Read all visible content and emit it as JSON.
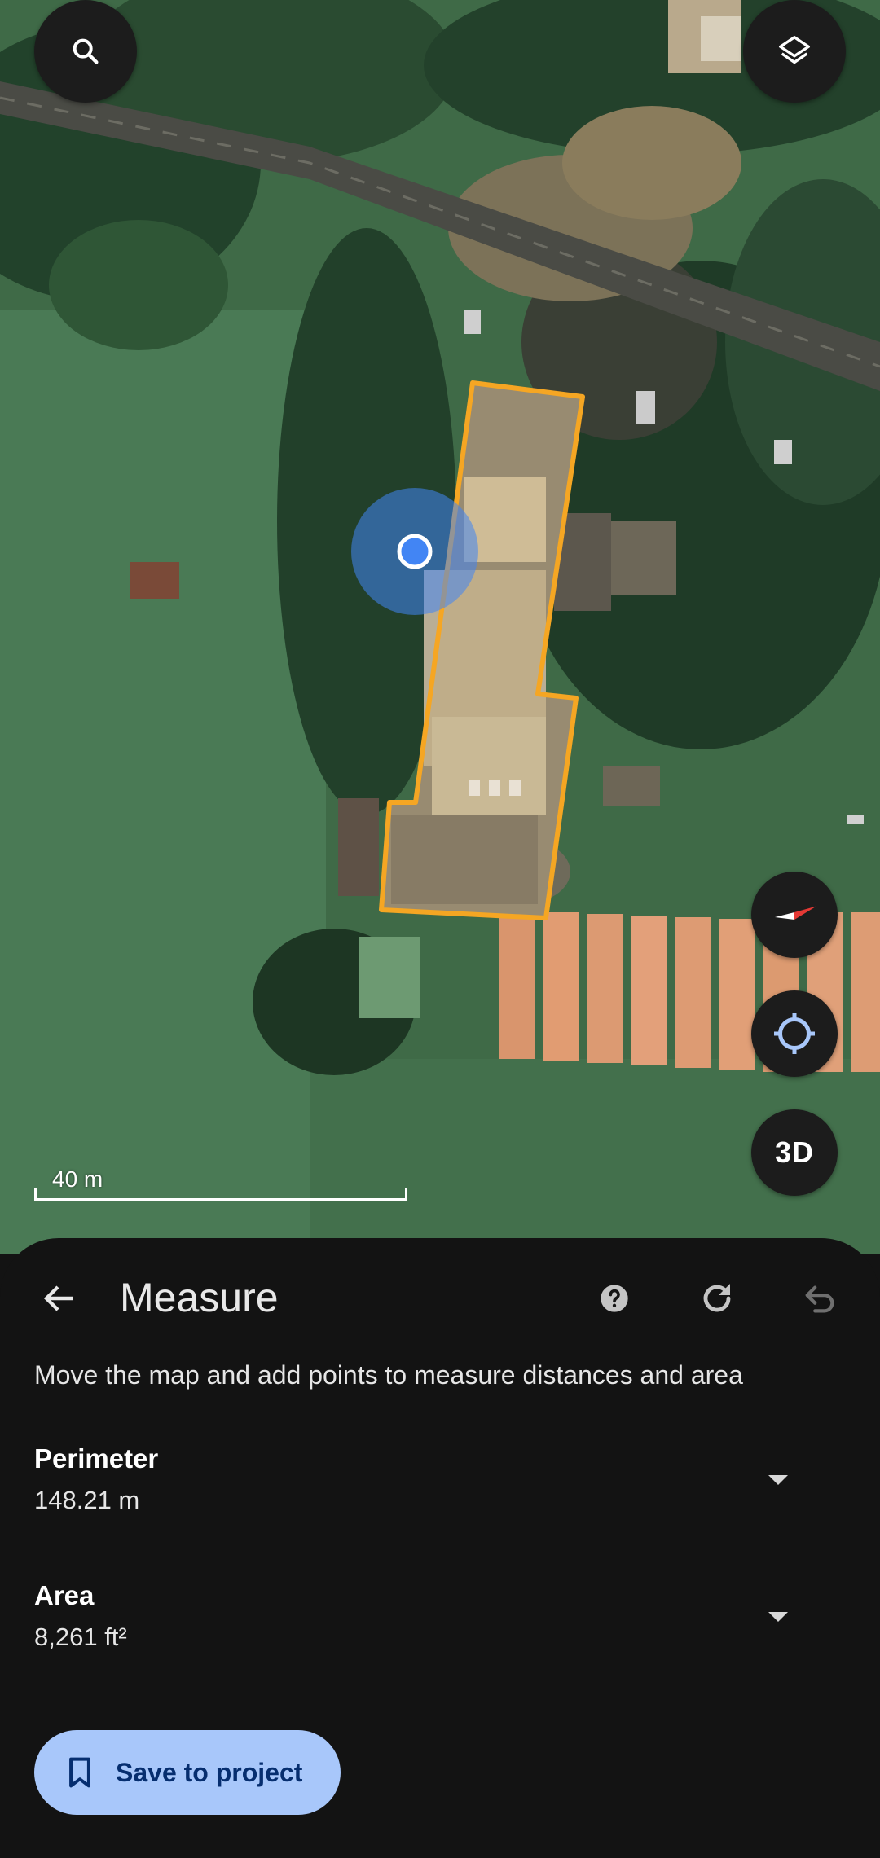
{
  "map": {
    "scale_label": "40 m"
  },
  "controls": {
    "search_icon": "search-icon",
    "layers_icon": "layers-icon",
    "compass_icon": "compass-icon",
    "location_icon": "my-location-icon",
    "three_d_label": "3D"
  },
  "sheet": {
    "title": "Measure",
    "instructions": "Move the map and add points to measure distances and area",
    "perimeter": {
      "label": "Perimeter",
      "value": "148.21 m"
    },
    "area": {
      "label": "Area",
      "value": "8,261 ft²"
    },
    "save_label": "Save to project"
  },
  "colors": {
    "measure_outline": "#f5a623",
    "location_dot": "#4285f4",
    "accent_button": "#a8c7fa",
    "sheet_bg": "#131313"
  }
}
